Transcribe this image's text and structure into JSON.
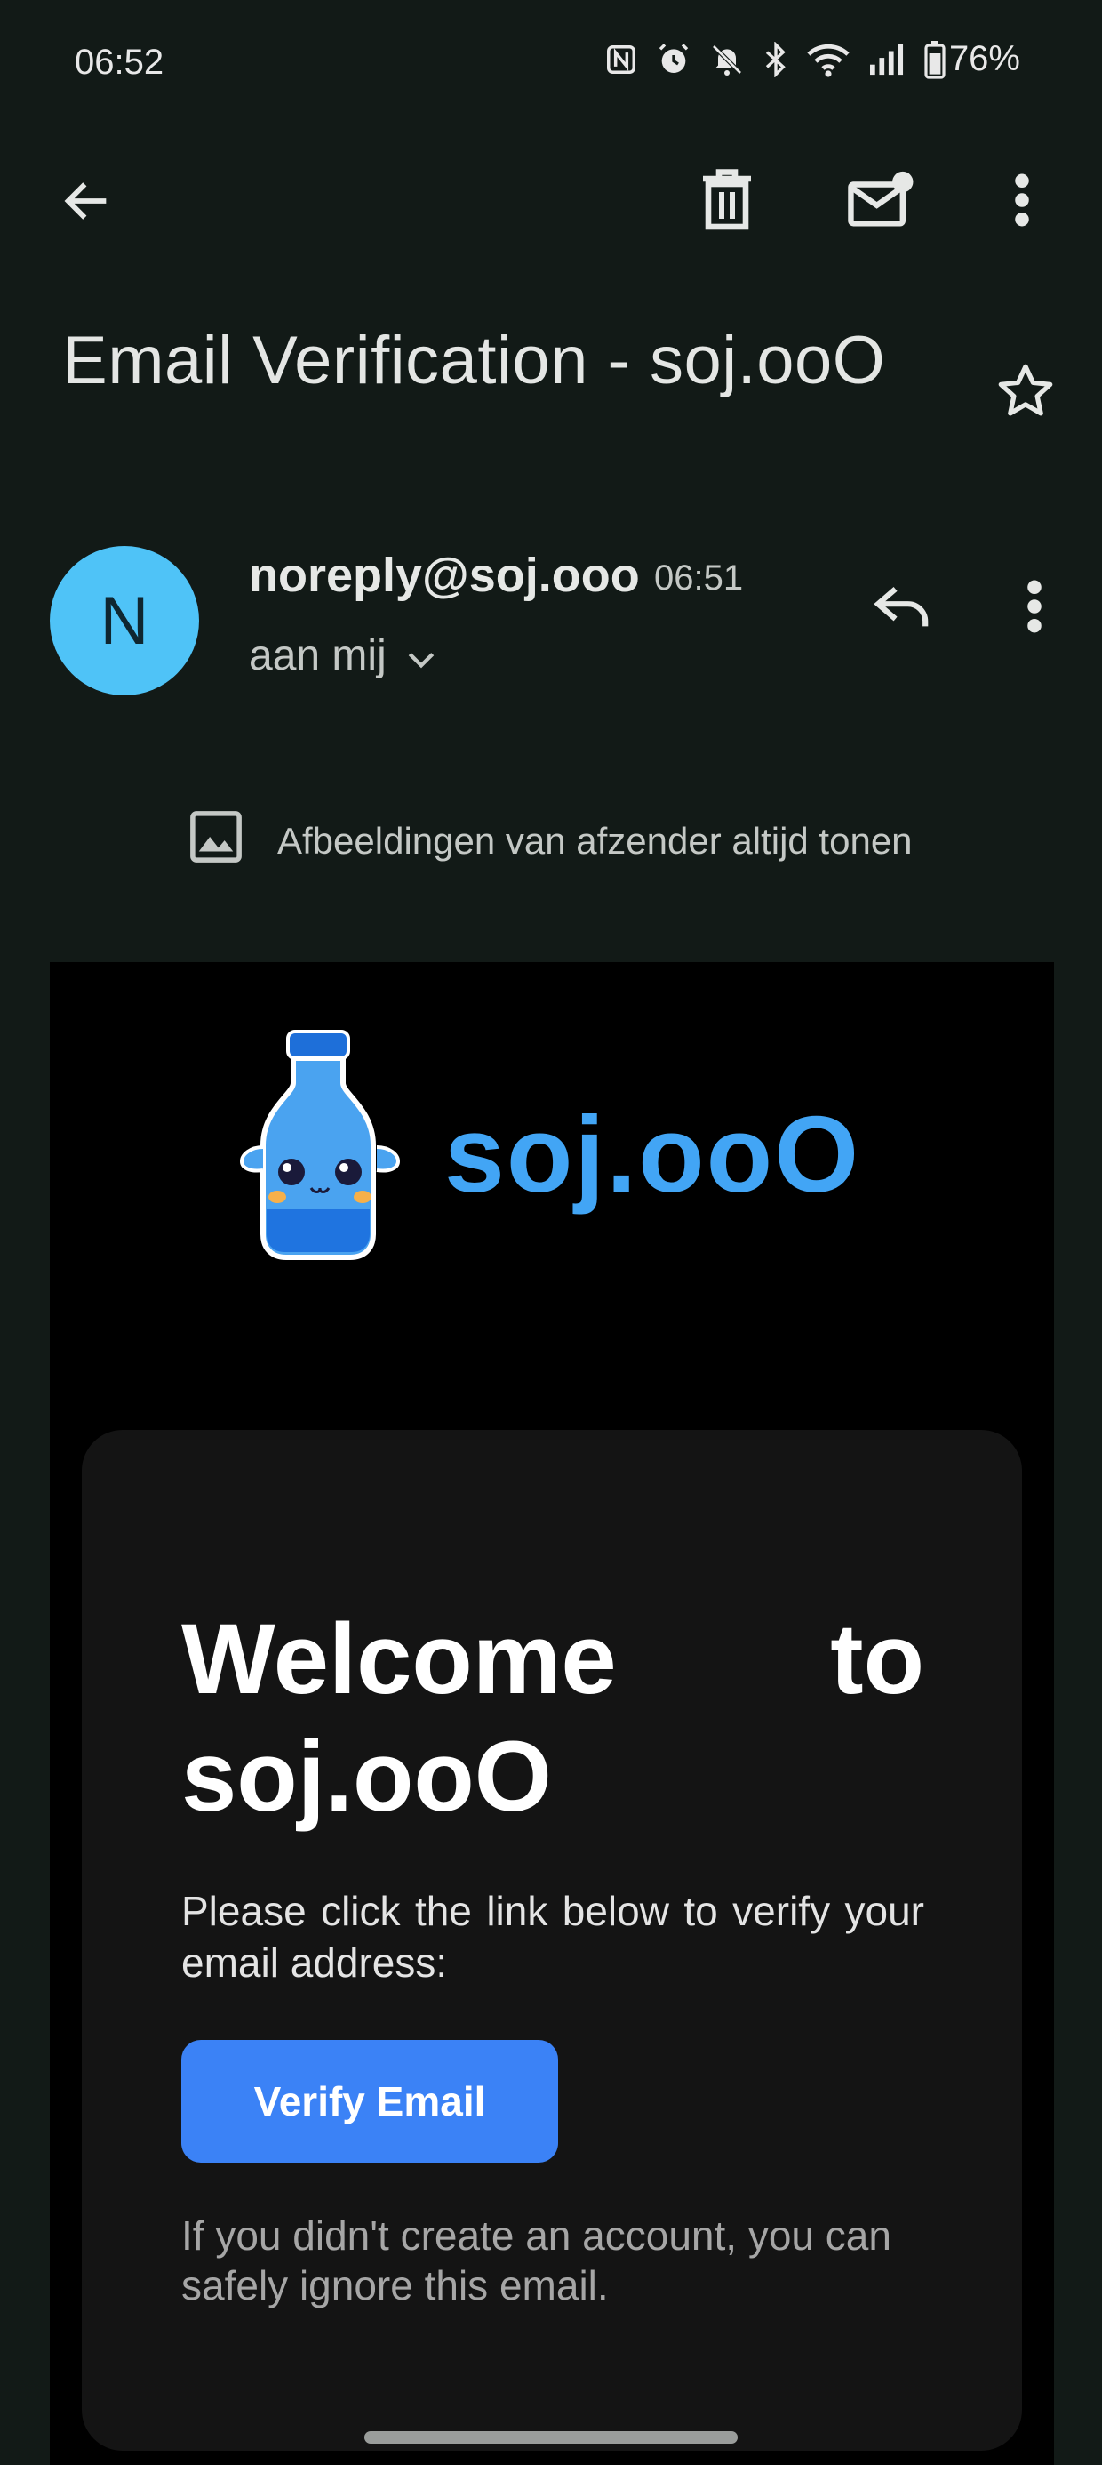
{
  "status_bar": {
    "time": "06:52",
    "battery": "76%",
    "icons": [
      "nfc-icon",
      "alarm-icon",
      "mute-icon",
      "bluetooth-icon",
      "wifi-icon",
      "signal-icon",
      "battery-icon"
    ]
  },
  "toolbar": {
    "icons": [
      "back-arrow-icon",
      "delete-icon",
      "mark-unread-icon",
      "more-vert-icon"
    ]
  },
  "subject": "Email Verification - soj.ooO",
  "sender": {
    "avatar_letter": "N",
    "address": "noreply@soj.ooo",
    "time": "06:51",
    "recipient": "aan mij"
  },
  "image_notice": "Afbeeldingen van afzender altijd tonen",
  "email": {
    "logo_text": "soj.ooO",
    "welcome_word1": "Welcome",
    "welcome_word2": "to",
    "welcome_line2": "soj.ooO",
    "instructions": "Please click the link below to verify your email address:",
    "button_label": "Verify Email",
    "footnote": "If you didn't create an account, you can safely ignore this email."
  },
  "colors": {
    "background": "#121a17",
    "avatar": "#4fc3f7",
    "brand": "#42a5f5",
    "button": "#3b82f6"
  }
}
